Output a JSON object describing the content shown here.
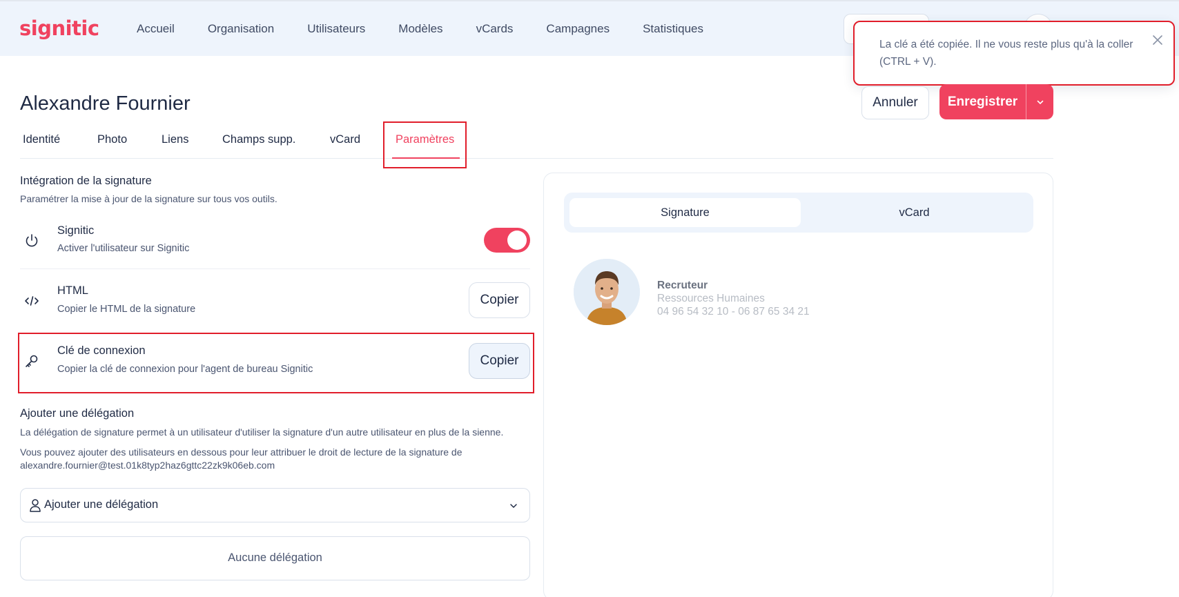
{
  "app": {
    "logo": "signitic"
  },
  "nav": {
    "items": [
      "Accueil",
      "Organisation",
      "Utilisateurs",
      "Modèles",
      "vCards",
      "Campagnes",
      "Statistiques"
    ]
  },
  "toast": {
    "message": "La clé a été copiée. Il ne vous reste plus qu'à la coller (CTRL + V)."
  },
  "header": {
    "title": "Alexandre Fournier",
    "cancel_label": "Annuler",
    "save_label": "Enregistrer"
  },
  "tabs": {
    "items": [
      "Identité",
      "Photo",
      "Liens",
      "Champs supp.",
      "vCard",
      "Paramètres"
    ],
    "active": "Paramètres"
  },
  "integration": {
    "title": "Intégration de la signature",
    "description": "Paramétrer la mise à jour de la signature sur tous vos outils.",
    "rows": [
      {
        "title": "Signitic",
        "description": "Activer l'utilisateur sur Signitic",
        "icon": "power-icon",
        "control": "toggle",
        "enabled": true
      },
      {
        "title": "HTML",
        "description": "Copier le HTML de la signature",
        "icon": "code-icon",
        "button": "Copier"
      },
      {
        "title": "Clé de connexion",
        "description": "Copier la clé de connexion pour l'agent de bureau Signitic",
        "icon": "key-icon",
        "button": "Copier"
      }
    ]
  },
  "delegation": {
    "title": "Ajouter une délégation",
    "description1": "La délégation de signature permet à un utilisateur d'utiliser la signature d'un autre utilisateur en plus de la sienne.",
    "description2": "Vous pouvez ajouter des utilisateurs en dessous pour leur attribuer le droit de lecture de la signature de",
    "email": "alexandre.fournier@test.01k8typ2haz6gttc22zk9k06eb.com",
    "select_placeholder": "Ajouter une délégation",
    "empty_label": "Aucune délégation"
  },
  "preview": {
    "tabs": [
      "Signature",
      "vCard"
    ],
    "active_tab": "Signature",
    "signature": {
      "role": "Recruteur",
      "department": "Ressources Humaines",
      "phones": "04 96 54 32 10 - 06 87 65 34 21"
    }
  },
  "colors": {
    "brand": "#f0425f",
    "nav_background": "#eef4fc",
    "text": "#1f2a44",
    "highlight": "#e11d2a"
  }
}
